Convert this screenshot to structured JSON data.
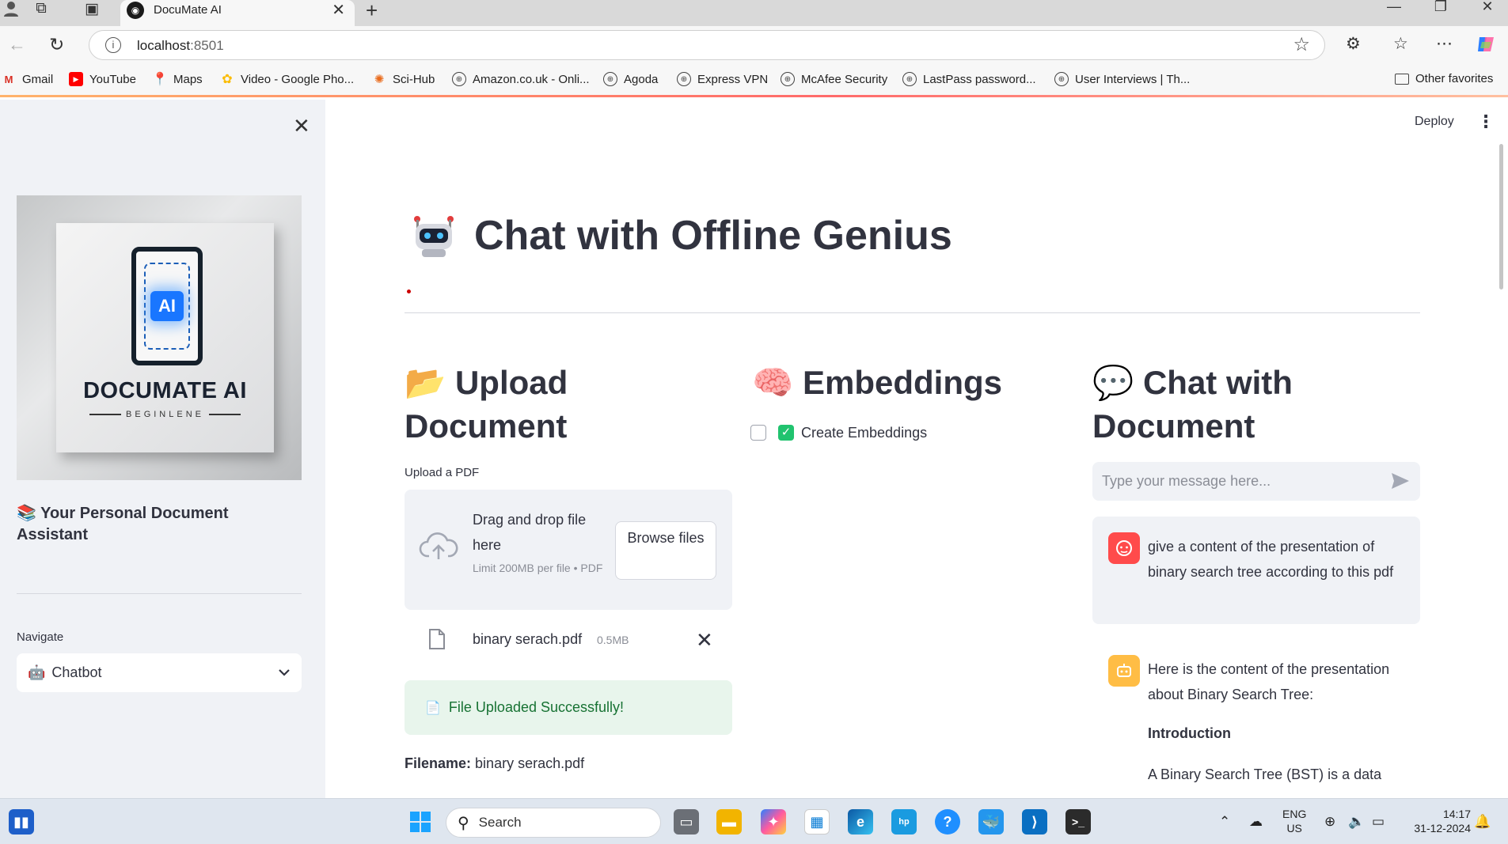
{
  "browser": {
    "tab_title": "DocuMate AI",
    "url_host": "localhost",
    "url_port": ":8501",
    "bookmarks": [
      {
        "label": "Gmail",
        "icon": "gmail-icon"
      },
      {
        "label": "YouTube",
        "icon": "youtube-icon"
      },
      {
        "label": "Maps",
        "icon": "maps-icon"
      },
      {
        "label": "Video - Google Pho...",
        "icon": "photos-icon"
      },
      {
        "label": "Sci-Hub",
        "icon": "scihub-icon"
      },
      {
        "label": "Amazon.co.uk - Onli...",
        "icon": "globe-icon"
      },
      {
        "label": "Agoda",
        "icon": "globe-icon"
      },
      {
        "label": "Express VPN",
        "icon": "globe-icon"
      },
      {
        "label": "McAfee Security",
        "icon": "globe-icon"
      },
      {
        "label": "LastPass password...",
        "icon": "globe-icon"
      },
      {
        "label": "User Interviews | Th...",
        "icon": "globe-icon"
      }
    ],
    "other_favorites": "Other favorites"
  },
  "sidebar": {
    "logo_text": "DOCUMATE AI",
    "logo_chip": "AI",
    "logo_sub": "BEGINLENE",
    "tagline": "📚 Your Personal Document Assistant",
    "nav_label": "Navigate",
    "nav_value": "Chatbot"
  },
  "header": {
    "deploy_label": "Deploy"
  },
  "main": {
    "title": "Chat with Offline Genius",
    "upload": {
      "heading": "📂 Upload Document",
      "field_label": "Upload a PDF",
      "drop_text": "Drag and drop file here",
      "limit_text": "Limit 200MB per file • PDF",
      "browse_label": "Browse files",
      "file_name": "binary serach.pdf",
      "file_size": "0.5MB",
      "success_text": "File Uploaded Successfully!",
      "filename_key": "Filename:",
      "filename_value": "binary serach.pdf"
    },
    "embeddings": {
      "heading": "🧠 Embeddings",
      "checkbox_label": "Create Embeddings",
      "checked": true
    },
    "chat": {
      "heading": "💬 Chat with Document",
      "input_placeholder": "Type your message here...",
      "user_message": "give a content of the presentation of binary search tree according to this pdf",
      "bot_intro": "Here is the content of the presentation about Binary Search Tree:",
      "bot_heading": "Introduction",
      "bot_paragraph": "A Binary Search Tree (BST) is a data"
    }
  },
  "taskbar": {
    "search_label": "Search",
    "lang_line1": "ENG",
    "lang_line2": "US",
    "time": "14:17",
    "date": "31-12-2024"
  },
  "colors": {
    "accent_red": "#ff4b4b",
    "bot_avatar": "#ffbd45",
    "success_bg": "#e8f5ec",
    "success_text": "#177233",
    "checkbox_green": "#21c36f",
    "panel_bg": "#f0f2f6"
  }
}
